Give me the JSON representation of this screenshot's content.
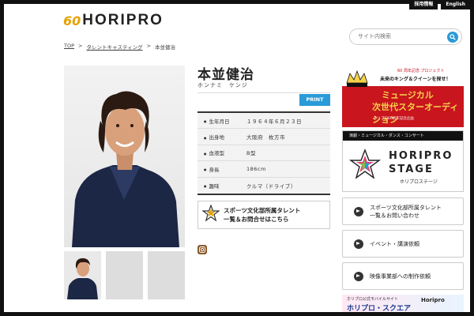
{
  "header": {
    "logo_prefix": "60",
    "logo_text": "HORIPRO",
    "top_links": [
      "採用情報",
      "English"
    ],
    "search_placeholder": "サイト内検索"
  },
  "breadcrumb": [
    "TOP",
    "タレントキャスティング",
    "本並健治"
  ],
  "talent": {
    "name": "本並健治",
    "kana": "ホンナミ　ケンジ",
    "print_label": "PRINT",
    "profile": [
      {
        "key": "生年月日",
        "value": "１９６４年６月２３日"
      },
      {
        "key": "出身地",
        "value": "大阪府　枚方市"
      },
      {
        "key": "血液型",
        "value": "B型"
      },
      {
        "key": "身長",
        "value": "186cm"
      },
      {
        "key": "趣味",
        "value": "クルマ（ドライブ）"
      }
    ]
  },
  "sports_banner": {
    "line1": "スポーツ文化部所属タレント",
    "line2": "一覧＆お問合せはこちら",
    "logo_caption": "HORIPRO"
  },
  "sidebar": {
    "ad1": {
      "small": "60 周年記念 プロジェクト",
      "line1": "未来のキング＆クイーンを探せ！",
      "big1": "ミュージカル",
      "big2": "次世代スターオーディション",
      "foot": "ホリプロ60周年記念企画"
    },
    "stage": {
      "head": "演劇・ミュージカル・ダンス・コンサート",
      "word1": "HORIPRO",
      "word2": "STAGE",
      "word3": "ホリプロステージ"
    },
    "nav": [
      {
        "label1": "スポーツ文化部所属タレント",
        "label2": "一覧＆お問い合わせ"
      },
      {
        "label1": "イベント・講演依頼",
        "label2": ""
      },
      {
        "label1": "映像事業部への制作依頼",
        "label2": ""
      }
    ],
    "ad2": {
      "t1": "ホリプロ公式モバイルサイト",
      "t2": "ホリプロ・スクエア",
      "logo": "Horipro"
    }
  },
  "colors": {
    "accent": "#2a9ad8",
    "brand_gold": "#e6a100",
    "ad_red": "#c9151e"
  }
}
